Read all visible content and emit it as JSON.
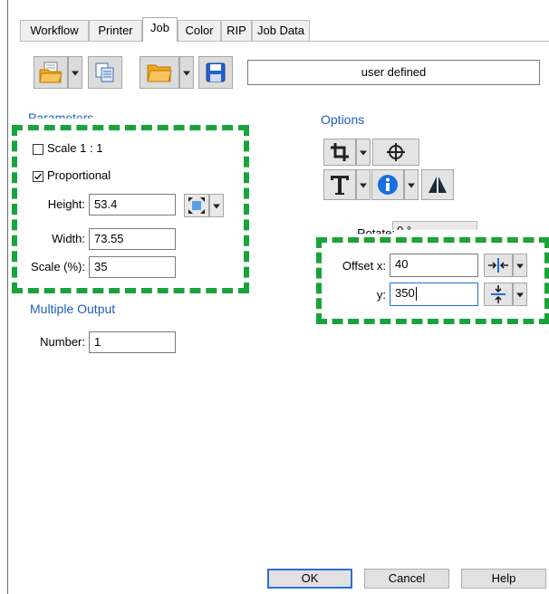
{
  "tabs": [
    {
      "label": "Workflow",
      "active": false
    },
    {
      "label": "Printer",
      "active": false
    },
    {
      "label": "Job",
      "active": true
    },
    {
      "label": "Color",
      "active": false
    },
    {
      "label": "RIP",
      "active": false
    },
    {
      "label": "Job Data",
      "active": false
    }
  ],
  "toolbar": {
    "preset_value": "user defined"
  },
  "parameters": {
    "title": "Parameters",
    "scale_1_1": {
      "label": "Scale 1 : 1",
      "checked": false
    },
    "proportional": {
      "label": "Proportional",
      "checked": true
    },
    "height": {
      "label": "Height:",
      "value": "53.4"
    },
    "width": {
      "label": "Width:",
      "value": "73.55"
    },
    "scale": {
      "label": "Scale (%):",
      "value": "35"
    }
  },
  "multiple_output": {
    "title": "Multiple Output",
    "number": {
      "label": "Number:",
      "value": "1"
    }
  },
  "options": {
    "title": "Options",
    "rotate": {
      "label": "Rotate:",
      "value": "0 °"
    },
    "offset_x": {
      "label": "Offset x:",
      "value": "40"
    },
    "offset_y": {
      "label": "y:",
      "value": "350"
    }
  },
  "buttons": {
    "ok": "OK",
    "cancel": "Cancel",
    "help": "Help"
  },
  "colors": {
    "accent_blue": "#1f5fbf",
    "highlight_green": "#1aa33b",
    "folder_orange": "#f2a51a",
    "save_blue": "#2560c8"
  },
  "icons": [
    "open-file-icon",
    "copy-pages-icon",
    "open-folder-icon",
    "save-disk-icon",
    "crop-icon",
    "crosshair-icon",
    "text-icon",
    "info-icon",
    "mirror-icon",
    "fit-to-page-icon",
    "center-horizontal-icon",
    "center-vertical-icon"
  ]
}
